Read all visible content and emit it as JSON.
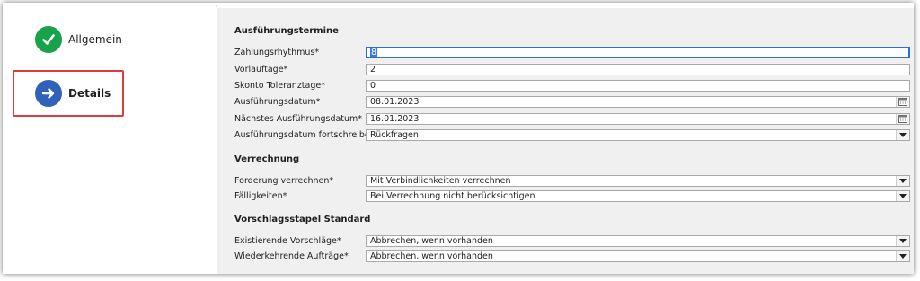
{
  "wizard": {
    "steps": [
      {
        "label": "Allgemein",
        "state": "done",
        "icon": "check-icon",
        "color": "#16a34a"
      },
      {
        "label": "Details",
        "state": "active",
        "icon": "arrow-right-icon",
        "color": "#2f62b8"
      }
    ],
    "highlight_color": "#e23b3b"
  },
  "form": {
    "section1": {
      "title": "Ausführungstermine",
      "fields": [
        {
          "label": "Zahlungsrhythmus*",
          "value": "8",
          "type": "text",
          "focused": true
        },
        {
          "label": "Vorlauftage*",
          "value": "2",
          "type": "text"
        },
        {
          "label": "Skonto Toleranztage*",
          "value": "0",
          "type": "text"
        },
        {
          "label": "Ausführungsdatum*",
          "value": "08.01.2023",
          "type": "date"
        },
        {
          "label": "Nächstes Ausführungsdatum*",
          "value": "16.01.2023",
          "type": "date"
        },
        {
          "label": "Ausführungsdatum fortschreiben*",
          "value": "Rückfragen",
          "type": "select"
        }
      ]
    },
    "section2": {
      "title": "Verrechnung",
      "fields": [
        {
          "label": "Forderung verrechnen*",
          "value": "Mit Verbindlichkeiten verrechnen",
          "type": "select"
        },
        {
          "label": "Fälligkeiten*",
          "value": "Bei Verrechnung nicht berücksichtigen",
          "type": "select"
        }
      ]
    },
    "section3": {
      "title": "Vorschlagsstapel Standard",
      "fields": [
        {
          "label": "Existierende Vorschläge*",
          "value": "Abbrechen, wenn vorhanden",
          "type": "select"
        },
        {
          "label": "Wiederkehrende Aufträge*",
          "value": "Abbrechen, wenn vorhanden",
          "type": "select"
        }
      ]
    }
  },
  "colors": {
    "form_background": "#f0f0f0",
    "focus_border": "#2b73c9"
  }
}
